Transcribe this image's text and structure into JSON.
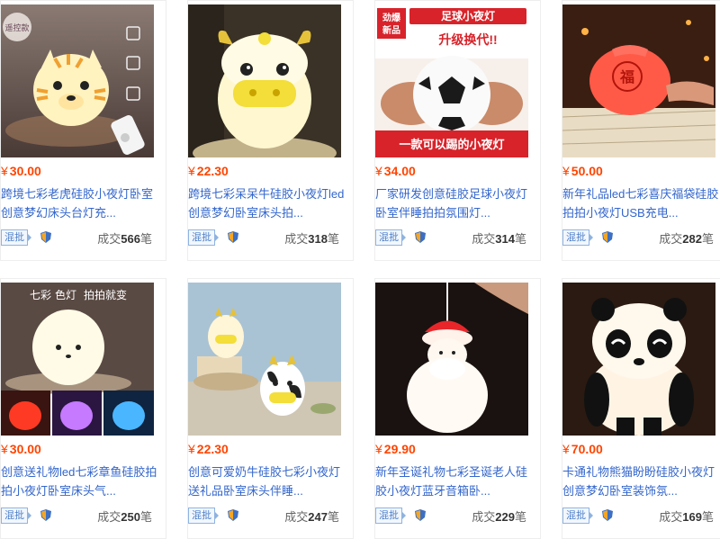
{
  "currency_symbol": "¥",
  "tag_label": "混批",
  "deal_prefix": "成交",
  "deal_unit": "笔",
  "products": [
    {
      "price": "30.00",
      "title": "跨境七彩老虎硅胶小夜灯卧室创意梦幻床头台灯充...",
      "deals": "566",
      "image": "tiger-lamp",
      "image_text": [
        "遥控款"
      ]
    },
    {
      "price": "22.30",
      "title": "跨境七彩呆呆牛硅胶小夜灯led创意梦幻卧室床头拍...",
      "deals": "318",
      "image": "cow-lamp",
      "image_text": []
    },
    {
      "price": "34.00",
      "title": "厂家研发创意硅胶足球小夜灯卧室伴睡拍拍氛围灯...",
      "deals": "314",
      "image": "football-lamp",
      "image_text": [
        "劲爆",
        "新品",
        "足球小夜灯",
        "升级换代!!",
        "一款可以踢的小夜灯"
      ]
    },
    {
      "price": "50.00",
      "title": "新年礼品led七彩喜庆福袋硅胶拍拍小夜灯USB充电...",
      "deals": "282",
      "image": "fortune-bag-lamp",
      "image_text": [
        "福"
      ]
    },
    {
      "price": "30.00",
      "title": "创意送礼物led七彩章鱼硅胶拍拍小夜灯卧室床头气...",
      "deals": "250",
      "image": "octopus-lamp",
      "image_text": [
        "七彩",
        "色灯",
        "拍拍就变"
      ]
    },
    {
      "price": "22.30",
      "title": "创意可爱奶牛硅胶七彩小夜灯送礼品卧室床头伴睡...",
      "deals": "247",
      "image": "dairy-cow-lamp",
      "image_text": []
    },
    {
      "price": "29.90",
      "title": "新年圣诞礼物七彩圣诞老人硅胶小夜灯蓝牙音箱卧...",
      "deals": "229",
      "image": "santa-lamp",
      "image_text": []
    },
    {
      "price": "70.00",
      "title": "卡通礼物熊猫盼盼硅胶小夜灯创意梦幻卧室装饰氛...",
      "deals": "169",
      "image": "panda-lamp",
      "image_text": []
    }
  ],
  "colors": {
    "price": "#ff4400",
    "title_link": "#3366cc",
    "tag_border": "#8fb3e0"
  }
}
